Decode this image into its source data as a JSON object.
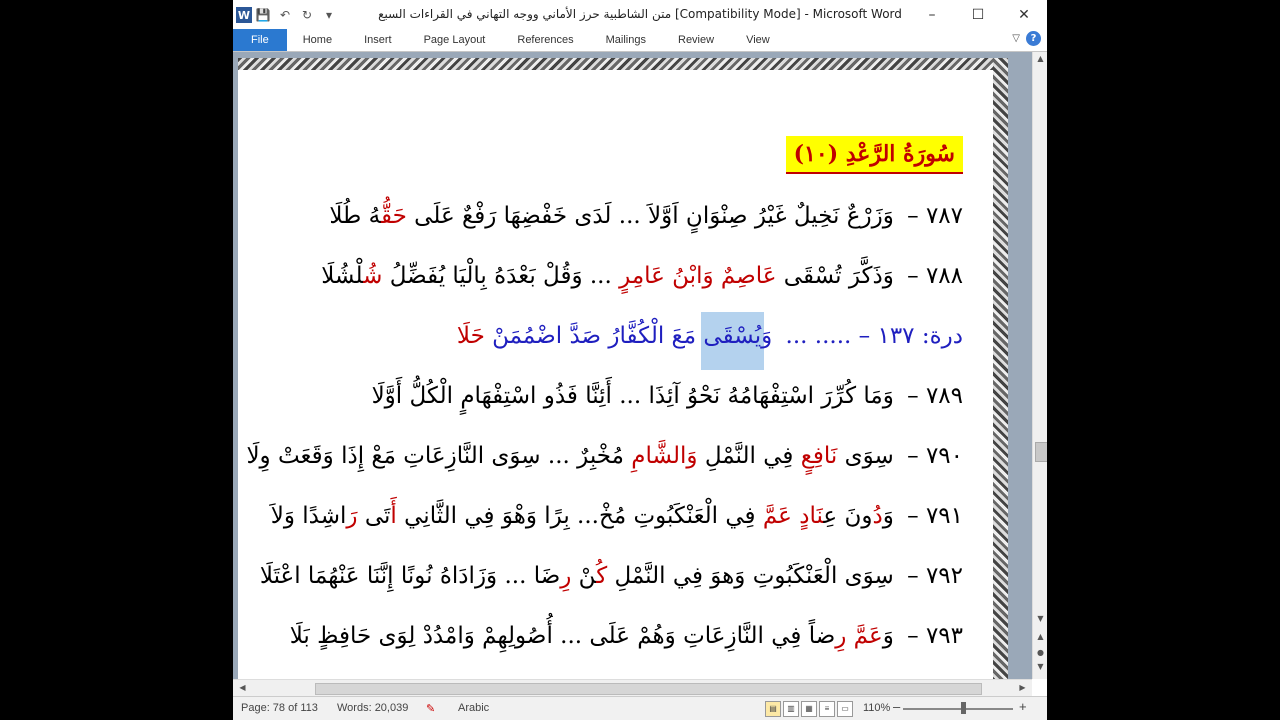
{
  "window": {
    "title": "متن الشاطبية حرز الأماني ووجه التهاني في القراءات السبع [Compatibility Mode]  -  Microsoft Word",
    "controls": {
      "minimize": "–",
      "maximize": "☐",
      "close": "✕"
    }
  },
  "quick_access": {
    "app_icon": "W"
  },
  "ribbon": {
    "tabs": [
      "File",
      "Home",
      "Insert",
      "Page Layout",
      "References",
      "Mailings",
      "Review",
      "View"
    ],
    "help": "?"
  },
  "document": {
    "heading": "سُورَةُ الرَّعْدِ (١٠)",
    "lines": [
      {
        "num": "٧٨٧ –",
        "parts": [
          {
            "t": "وَزَرْعٌ نَخِيلٌ غَيْرُ صِنْوَانٍ اَوَّلاَ ... لَدَى خَفْضِهَا رَفْعٌ عَ"
          },
          {
            "t": "لَى",
            "red": false
          },
          {
            "t": " حَقُّ",
            "red": true
          },
          {
            "t": "هُ طُلَا"
          }
        ]
      },
      {
        "num": "٧٨٨ –",
        "parts": [
          {
            "t": "وَذَكَّرَ تُسْقَى "
          },
          {
            "t": "عَاصِمٌ وَابْنُ عَامِرٍ",
            "red": true
          },
          {
            "t": " ... وَقُلْ بَعْدَهُ بِالْيَا يُفَضِّلُ "
          },
          {
            "t": "شُ",
            "red": true
          },
          {
            "t": "لْشُلَا"
          }
        ]
      },
      {
        "num": "درة: ١٣٧ – ..... ...",
        "blue": true,
        "parts": [
          {
            "t": " وَيُسْقَى مَعَ الْكُفَّارُ صَدَّ اضْمُمَنْ "
          },
          {
            "t": "حَلَا",
            "red": true
          }
        ]
      },
      {
        "num": "٧٨٩ –",
        "parts": [
          {
            "t": "وَمَا كُرِّرَ اسْتِفْهَامُهُ نَحْوُ آئِذَا ... أَئِنَّا فَذُو اسْتِفْهَامٍ الْكُلُّ أَوَّلَا"
          }
        ]
      },
      {
        "num": "٧٩٠ –",
        "parts": [
          {
            "t": "سِوَى "
          },
          {
            "t": "نَافِعٍ",
            "red": true
          },
          {
            "t": " فِي النَّمْلِ "
          },
          {
            "t": "وَالشَّامِ",
            "red": true
          },
          {
            "t": " مُخْبِرٌ ... سِوَى النَّازِعَاتِ مَعْ إِذَا وَقَعَتْ وِلَا"
          }
        ]
      },
      {
        "num": "٧٩١ –",
        "parts": [
          {
            "t": "وَ"
          },
          {
            "t": "دُ",
            "red": true
          },
          {
            "t": "ونَ عِ"
          },
          {
            "t": "نَادٍ",
            "red": true
          },
          {
            "t": " "
          },
          {
            "t": "عَمَّ",
            "red": true
          },
          {
            "t": " فِي الْعَنْكَبُوتِ مُخْ... بِرًا وَهْوَ فِي الثَّانِي "
          },
          {
            "t": "أَ",
            "red": true
          },
          {
            "t": "تَى "
          },
          {
            "t": "رَ",
            "red": true
          },
          {
            "t": "اشِدًا وَلاَ"
          }
        ]
      },
      {
        "num": "٧٩٢ –",
        "parts": [
          {
            "t": "سِوَى الْعَنْكَبُوتِ وَهوَ فِي النَّمْلِ "
          },
          {
            "t": "كُ",
            "red": true
          },
          {
            "t": "نْ "
          },
          {
            "t": "رِ",
            "red": true
          },
          {
            "t": "ضَا ... وَزَادَاهُ نُونًا إِنَّنَا عَنْهُمَا اعْتَلَا"
          }
        ]
      },
      {
        "num": "٧٩٣ –",
        "parts": [
          {
            "t": "وَ"
          },
          {
            "t": "عَمَّ",
            "red": true
          },
          {
            "t": " "
          },
          {
            "t": "رِ",
            "red": true
          },
          {
            "t": "ضاً فِي النَّازِعَاتِ وَهُمْ عَلَى ... أُصُولِهِمْ وَامْدُدْ لِوَى حَافِظٍ بَلَا"
          }
        ]
      }
    ]
  },
  "statusbar": {
    "page": "Page: 78 of 113",
    "words": "Words: 20,039",
    "language": "Arabic",
    "zoom": "110%",
    "zoom_minus": "–",
    "zoom_plus": "+"
  }
}
